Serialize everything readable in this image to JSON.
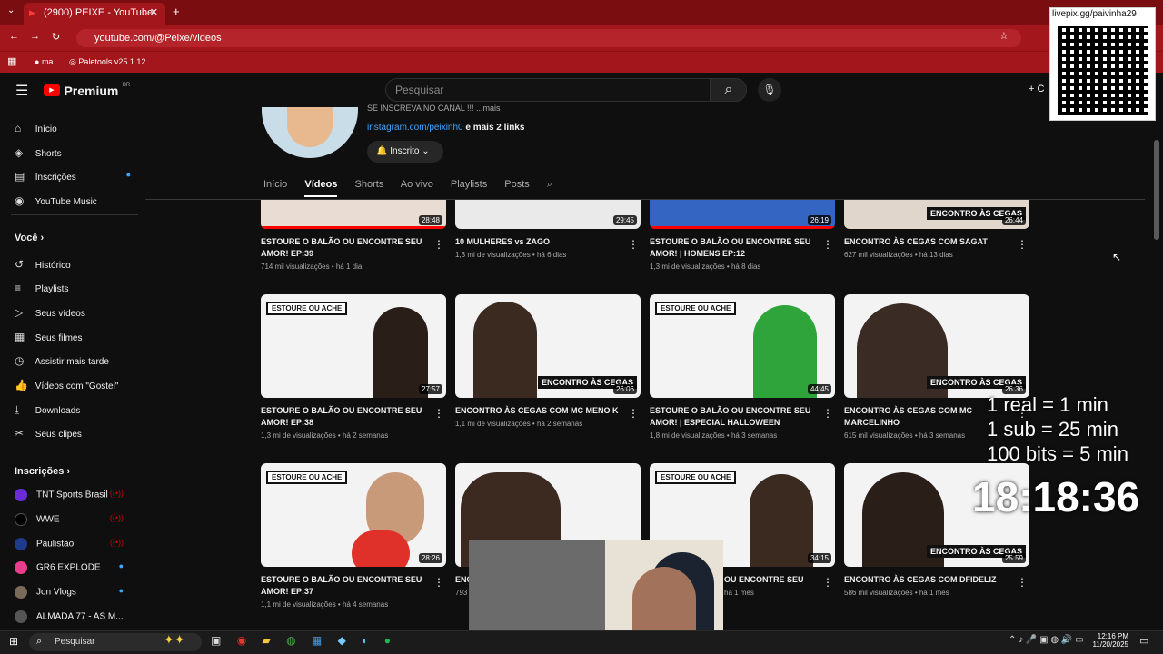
{
  "browser": {
    "tab_title": "(2900) PEIXE - YouTube",
    "url": "youtube.com/@Peixe/videos",
    "bookmarks": [
      "ma",
      "Paletools v25.1.12"
    ]
  },
  "youtube": {
    "logo": "Premium",
    "logo_badge": "BR",
    "search_placeholder": "Pesquisar",
    "create_label": "+ C"
  },
  "channel": {
    "desc_line": "SE INSCREVA NO CANAL !!! ...mais",
    "link": "instagram.com/peixinh0",
    "link_more": "e mais 2 links",
    "subscribed": "Inscrito",
    "tabs": [
      "Início",
      "Vídeos",
      "Shorts",
      "Ao vivo",
      "Playlists",
      "Posts"
    ]
  },
  "sidebar": {
    "main": [
      "Início",
      "Shorts",
      "Inscrições",
      "YouTube Music"
    ],
    "you_title": "Você",
    "you": [
      "Histórico",
      "Playlists",
      "Seus vídeos",
      "Seus filmes",
      "Assistir mais tarde",
      "Vídeos com \"Gostei\"",
      "Downloads",
      "Seus clipes"
    ],
    "subs_title": "Inscrições",
    "subs": [
      "TNT Sports Brasil",
      "WWE",
      "Paulistão",
      "GR6 EXPLODE",
      "Jon Vlogs",
      "ALMADA 77 - AS M..."
    ]
  },
  "videos": [
    {
      "title": "ESTOURE O BALÃO OU ENCONTRE SEU AMOR! EP:39",
      "meta": "714 mil visualizações • há 1 dia",
      "duration": "28:48"
    },
    {
      "title": "10 MULHERES vs ZAGO",
      "meta": "1,3 mi de visualizações • há 6 dias",
      "duration": "29:45"
    },
    {
      "title": "ESTOURE O BALÃO OU ENCONTRE SEU AMOR! | HOMENS EP:12",
      "meta": "1,3 mi de visualizações • há 8 dias",
      "duration": "26:19"
    },
    {
      "title": "ENCONTRO ÀS CEGAS COM SAGAT",
      "meta": "627 mil visualizações • há 13 dias",
      "duration": "26:44"
    },
    {
      "title": "ESTOURE O BALÃO OU ENCONTRE SEU AMOR! EP:38",
      "meta": "1,3 mi de visualizações • há 2 semanas",
      "duration": "27:57"
    },
    {
      "title": "ENCONTRO ÀS CEGAS COM MC MENO K",
      "meta": "1,1 mi de visualizações • há 2 semanas",
      "duration": "26:06"
    },
    {
      "title": "ESTOURE O BALÃO OU ENCONTRE SEU AMOR! | ESPECIAL HALLOWEEN",
      "meta": "1,8 mi de visualizações • há 3 semanas",
      "duration": "44:45"
    },
    {
      "title": "ENCONTRO ÀS CEGAS COM MC MARCELINHO",
      "meta": "615 mil visualizações • há 3 semanas",
      "duration": "26:36"
    },
    {
      "title": "ESTOURE O BALÃO OU ENCONTRE SEU AMOR! EP:37",
      "meta": "1,1 mi de visualizações • há 4 semanas",
      "duration": "28:26"
    },
    {
      "title": "ENC",
      "meta": "793",
      "duration": ""
    },
    {
      "title": "OU ENCONTRE SEU",
      "meta": "há 1 mês",
      "duration": "34:15"
    },
    {
      "title": "ENCONTRO ÀS CEGAS COM DFIDELIZ",
      "meta": "586 mil visualizações • há 1 mês",
      "duration": "25:59"
    }
  ],
  "thumb_labels": {
    "estoure": "ESTOURE OU ACHE",
    "cegas": "ENCONTRO ÀS CEGAS"
  },
  "stream_overlay": {
    "qr_text": "livepix.gg/paivinha29",
    "lines": [
      "1 real = 1 min",
      "1 sub = 25 min",
      "100 bits = 5 min"
    ],
    "timer": "18:18:36"
  },
  "taskbar": {
    "search": "Pesquisar",
    "time": "12:16 PM",
    "date": "11/20/2025"
  }
}
